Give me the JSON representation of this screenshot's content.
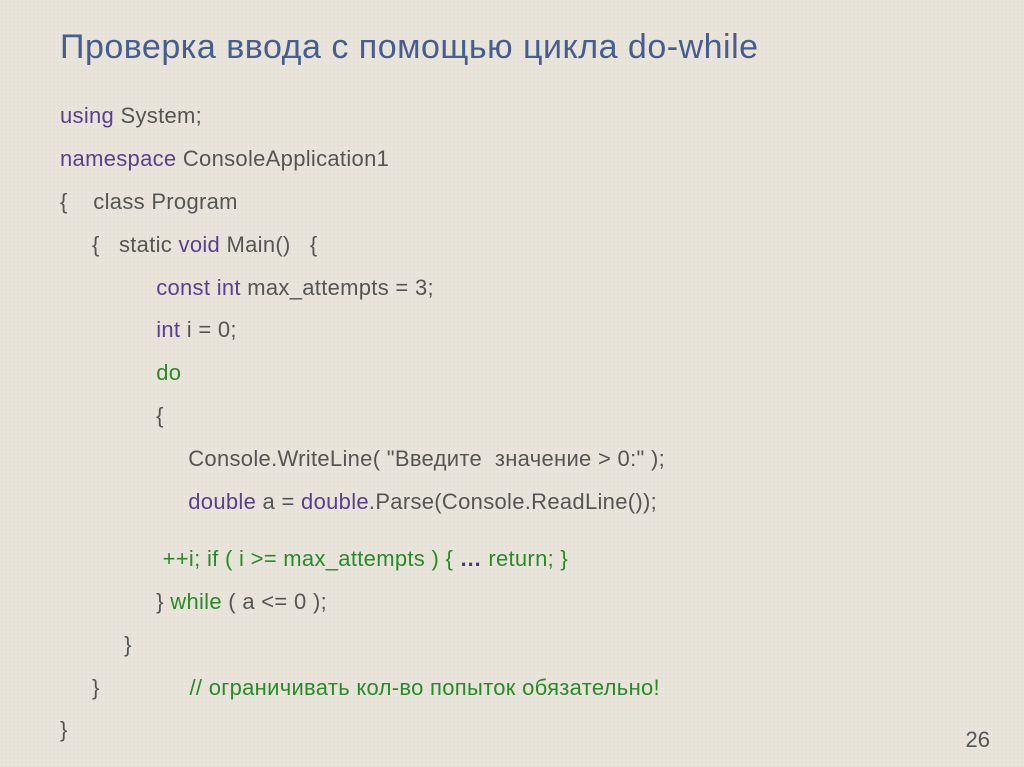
{
  "title": "Проверка ввода с помощью цикла do-while",
  "code": {
    "l1a": "using",
    "l1b": " System;",
    "l2a": "namespace",
    "l2b": " ConsoleApplication1",
    "l3a": "{    ",
    "l3b": "class",
    "l3c": " Program",
    "l4a": "     {   ",
    "l4b": "static",
    "l4c": " ",
    "l4d": "void",
    "l4e": " Main()   {",
    "l5a": "               ",
    "l5b": "const",
    "l5c": " ",
    "l5d": "int",
    "l5e": " max_attempts = 3;",
    "l6a": "               ",
    "l6b": "int",
    "l6c": " i = 0;",
    "l7a": "               ",
    "l7b": "do",
    "l8a": "               {",
    "l9a": "                    Console.WriteLine( \"Введите  значение > 0:\" );",
    "l10a": "                    ",
    "l10b": "double",
    "l10c": " a = ",
    "l10d": "double",
    "l10e": ".Parse(Console.ReadLine());",
    "l11a": "                ",
    "l11b": "++i;",
    "l11c": " ",
    "l11d": "if",
    "l11e": " ( i >= max_attempts ) { ",
    "l11f": "…",
    "l11g": " ",
    "l11h": "return",
    "l11i": "; }",
    "l12a": "               } ",
    "l12b": "while",
    "l12c": " ( a <= 0 );",
    "l13a": "          }",
    "l14a": "     }              ",
    "l14b": "// ограничивать кол-во попыток обязательно!",
    "l15a": "}"
  },
  "page_number": "26"
}
